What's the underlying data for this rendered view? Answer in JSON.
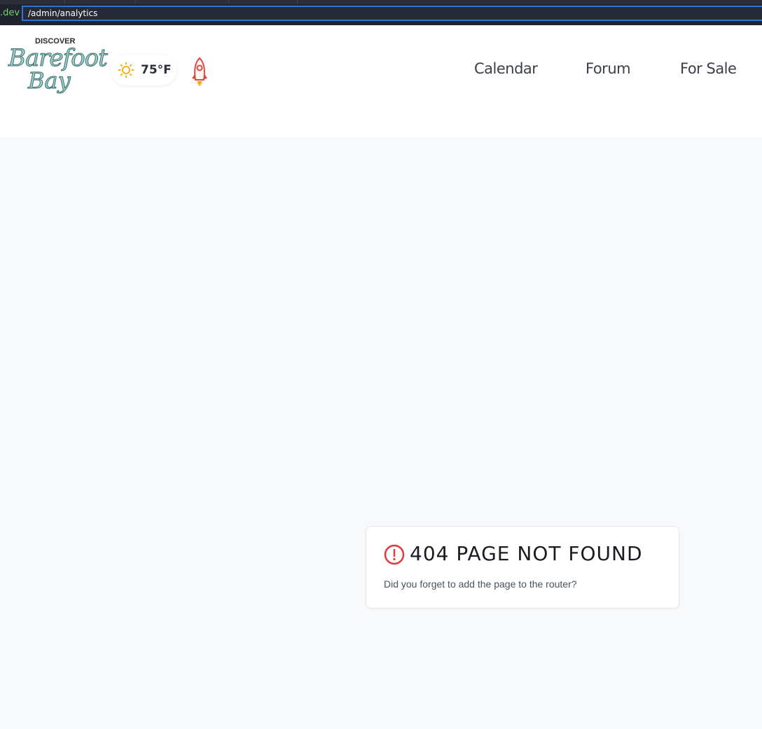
{
  "browser": {
    "domain_fragment": ".dev",
    "url": "/admin/analytics"
  },
  "logo": {
    "top": "DISCOVER",
    "line1": "Barefoot",
    "line2": "Bay"
  },
  "weather": {
    "icon": "sun-icon",
    "temperature": "75°F"
  },
  "rocket_icon": "rocket-icon",
  "nav": {
    "items": [
      {
        "label": "Calendar"
      },
      {
        "label": "Forum"
      },
      {
        "label": "For Sale"
      }
    ]
  },
  "error_card": {
    "icon": "alert-circle-icon",
    "title": "404 PAGE NOT FOUND",
    "message": "Did you forget to add the page to the router?",
    "accent_color": "#e03a3a"
  }
}
